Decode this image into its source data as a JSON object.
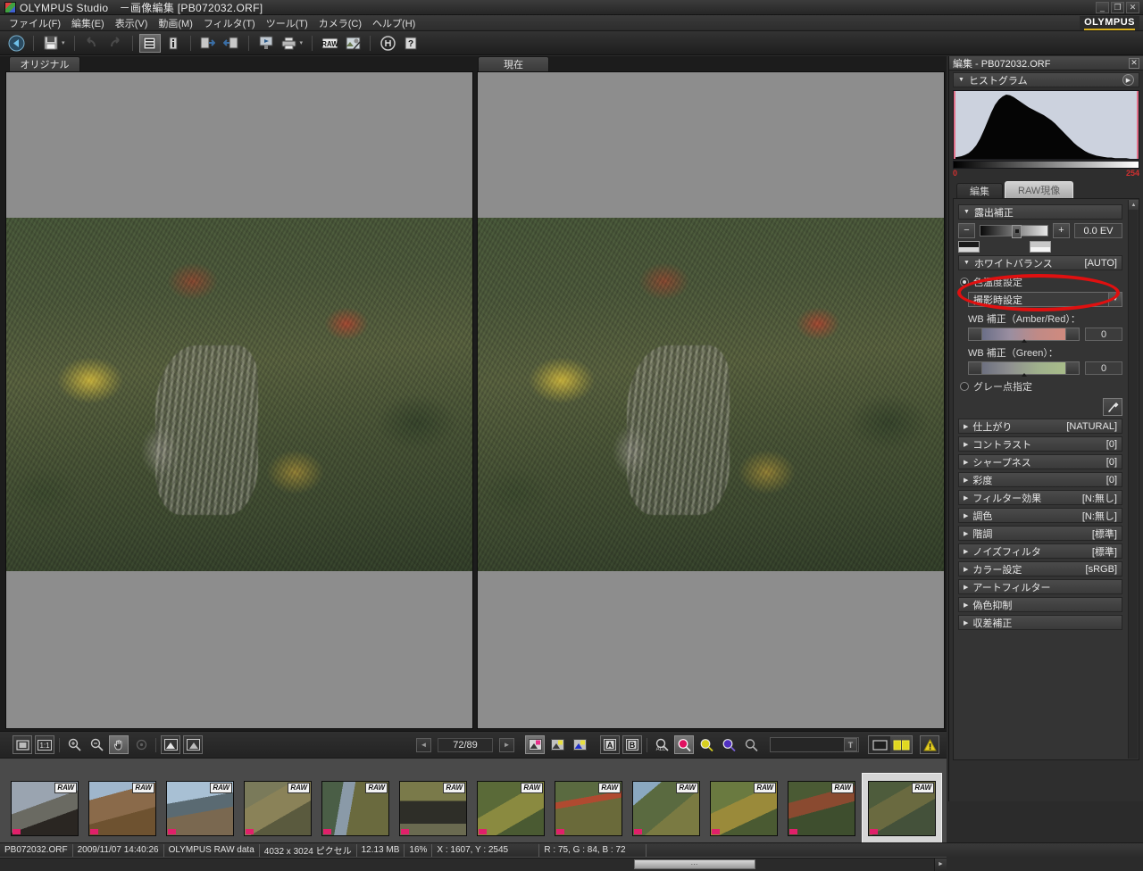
{
  "titlebar": {
    "app_name": "OLYMPUS Studio",
    "separator": "－",
    "mode": "画像編集",
    "filename": "[PB072032.ORF]",
    "full": "OLYMPUS Studio　－画像編集 [PB072032.ORF]",
    "buttons": {
      "minimize": "_",
      "restore": "❐",
      "close": "✕"
    }
  },
  "menubar": {
    "items": [
      {
        "label": "ファイル(F)"
      },
      {
        "label": "編集(E)"
      },
      {
        "label": "表示(V)"
      },
      {
        "label": "動画(M)"
      },
      {
        "label": "フィルタ(T)"
      },
      {
        "label": "ツール(T)"
      },
      {
        "label": "カメラ(C)"
      },
      {
        "label": "ヘルプ(H)"
      }
    ],
    "brand": "OLYMPUS"
  },
  "toolbar": {
    "buttons": [
      {
        "name": "back-icon",
        "glyph": "◄"
      },
      {
        "name": "save-icon",
        "glyph": "💾"
      },
      {
        "name": "undo-icon",
        "glyph": "↶"
      },
      {
        "name": "redo-icon",
        "glyph": "↷"
      },
      {
        "name": "list-view-icon",
        "glyph": "▤"
      },
      {
        "name": "info-icon",
        "glyph": "i"
      },
      {
        "name": "export-right-icon",
        "glyph": "⇥"
      },
      {
        "name": "import-left-icon",
        "glyph": "⇤"
      },
      {
        "name": "slideshow-icon",
        "glyph": "▣"
      },
      {
        "name": "print-icon",
        "glyph": "🖶"
      },
      {
        "name": "raw-icon",
        "glyph": "RAW"
      },
      {
        "name": "edit-image-icon",
        "glyph": "◩"
      },
      {
        "name": "tools-icon",
        "glyph": "⚒"
      },
      {
        "name": "help-icon",
        "glyph": "?"
      }
    ]
  },
  "preview": {
    "tabs": [
      {
        "label": "オリジナル"
      },
      {
        "label": "現在"
      }
    ]
  },
  "bottom_toolbar": {
    "left_tools": [
      {
        "name": "fit-window-icon",
        "glyph": "▭"
      },
      {
        "name": "actual-size-icon",
        "glyph": "1:1"
      },
      {
        "name": "zoom-in-icon",
        "glyph": "🔍"
      },
      {
        "name": "zoom-out-icon",
        "glyph": "🔍"
      },
      {
        "name": "hand-tool-icon",
        "glyph": "✋"
      },
      {
        "name": "target-icon",
        "glyph": "◎"
      },
      {
        "name": "compare-left-icon",
        "glyph": "◣"
      },
      {
        "name": "compare-right-icon",
        "glyph": "◢"
      }
    ],
    "prev_label": "◄",
    "next_label": "►",
    "page_counter": "72/89",
    "center_tools": [
      {
        "name": "highlight-warning-icon",
        "glyph": "◩"
      },
      {
        "name": "shadow-warning-icon",
        "glyph": "◪"
      },
      {
        "name": "blue-warning-icon",
        "glyph": "◩"
      },
      {
        "name": "channel-a-icon",
        "glyph": "A"
      },
      {
        "name": "channel-b-icon",
        "glyph": "B"
      }
    ],
    "zoom_tools": [
      {
        "name": "zoom-all-icon",
        "glyph": "🔍"
      },
      {
        "name": "zoom-red-icon",
        "glyph": "🔍"
      },
      {
        "name": "zoom-yellow-icon",
        "glyph": "🔍"
      },
      {
        "name": "zoom-blue-icon",
        "glyph": "🔍"
      },
      {
        "name": "zoom-gray-icon",
        "glyph": "🔍"
      }
    ],
    "text_field_value": "",
    "text_field_button": "T",
    "view_single": "▭",
    "view_dual": "◫",
    "alert_icon": "⚠"
  },
  "filmstrip": {
    "raw_badge": "RAW",
    "thumbnails": [
      {
        "name": "thumb-1",
        "selected": false
      },
      {
        "name": "thumb-2",
        "selected": false
      },
      {
        "name": "thumb-3",
        "selected": false
      },
      {
        "name": "thumb-4",
        "selected": false
      },
      {
        "name": "thumb-5",
        "selected": false
      },
      {
        "name": "thumb-6",
        "selected": false
      },
      {
        "name": "thumb-7",
        "selected": false
      },
      {
        "name": "thumb-8",
        "selected": false
      },
      {
        "name": "thumb-9",
        "selected": false
      },
      {
        "name": "thumb-10",
        "selected": false
      },
      {
        "name": "thumb-11",
        "selected": false
      },
      {
        "name": "thumb-12",
        "selected": true
      }
    ],
    "scroll_grip": "⋯",
    "scroll_right": "►"
  },
  "right_panel": {
    "title": "編集 - PB072032.ORF",
    "close_glyph": "✕",
    "histogram": {
      "label": "ヒストグラム",
      "play_glyph": "▶",
      "min_label": "0",
      "max_label": "254"
    },
    "tabs": [
      {
        "label": "編集",
        "selected": false
      },
      {
        "label": "RAW現像",
        "selected": true
      }
    ],
    "exposure": {
      "label": "露出補正",
      "minus": "−",
      "plus": "+",
      "value": "0.0 EV"
    },
    "white_balance": {
      "label": "ホワイトバランス",
      "value": "[AUTO]",
      "color_temp_radio_label": "色温度設定",
      "preset_value": "撮影時設定",
      "dropdown_arrow": "▼",
      "amber_red_label": "WB 補正（Amber/Red）：",
      "amber_red_value": "0",
      "green_label": "WB 補正（Green）：",
      "green_value": "0",
      "gray_point_label": "グレー点指定",
      "eyedropper_glyph": "⁄"
    },
    "sections": [
      {
        "label": "仕上がり",
        "value": "[NATURAL]"
      },
      {
        "label": "コントラスト",
        "value": "[0]"
      },
      {
        "label": "シャープネス",
        "value": "[0]"
      },
      {
        "label": "彩度",
        "value": "[0]"
      },
      {
        "label": "フィルター効果",
        "value": "[N:無し]"
      },
      {
        "label": "調色",
        "value": "[N:無し]"
      },
      {
        "label": "階調",
        "value": "[標準]"
      },
      {
        "label": "ノイズフィルタ",
        "value": "[標準]"
      },
      {
        "label": "カラー設定",
        "value": "[sRGB]"
      },
      {
        "label": "アートフィルター",
        "value": ""
      },
      {
        "label": "偽色抑制",
        "value": ""
      },
      {
        "label": "収差補正",
        "value": ""
      }
    ],
    "scroll_up": "▲",
    "scroll_down": "▼"
  },
  "statusbar": {
    "filename": "PB072032.ORF",
    "datetime": "2009/11/07 14:40:26",
    "format": "OLYMPUS RAW data",
    "dimensions": "4032 x 3024 ピクセル",
    "filesize": "12.13 MB",
    "zoom": "16%",
    "coordinates": "X : 1607, Y : 2545",
    "rgb": "R : 75, G : 84, B : 72"
  },
  "colors": {
    "accent_yellow": "#d8b020",
    "annotation_red": "#e01010",
    "marker_pink": "#e0206a",
    "histogram_bg": "#ccd2de"
  },
  "chart_data": {
    "type": "area",
    "title": "ヒストグラム",
    "xlabel": "",
    "ylabel": "",
    "xlim": [
      0,
      254
    ],
    "x_tick_labels": [
      "0",
      "254"
    ],
    "grid": false,
    "legend": "none",
    "series": [
      {
        "name": "luminance",
        "values": [
          2,
          3,
          4,
          6,
          9,
          14,
          21,
          31,
          44,
          58,
          72,
          84,
          92,
          97,
          100,
          99,
          96,
          92,
          88,
          84,
          80,
          77,
          74,
          71,
          68,
          64,
          60,
          55,
          49,
          43,
          37,
          31,
          25,
          20,
          16,
          12,
          9,
          7,
          5,
          4,
          3,
          2,
          2,
          1,
          1,
          1,
          1,
          0,
          0,
          0
        ]
      }
    ]
  }
}
